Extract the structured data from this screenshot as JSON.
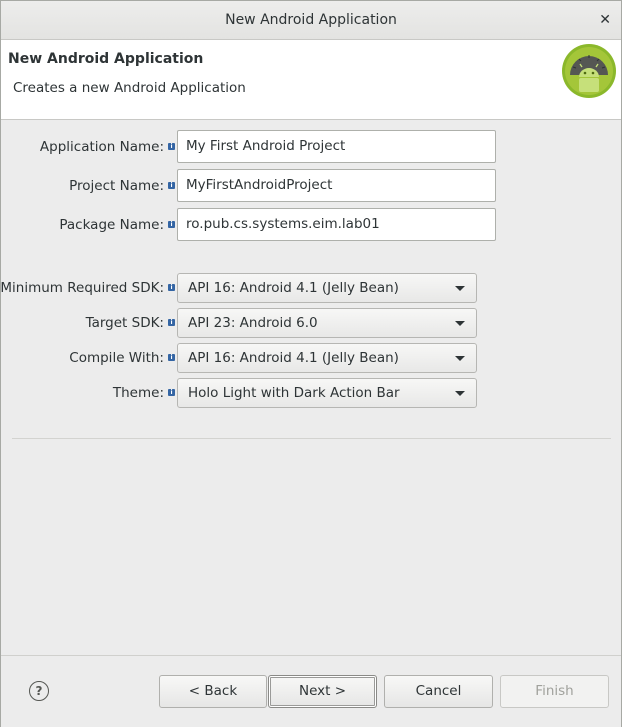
{
  "window": {
    "title": "New Android Application",
    "close_label": "✕"
  },
  "banner": {
    "title": "New Android Application",
    "description": "Creates a new Android Application",
    "logo_icon": "android-logo-icon"
  },
  "fields": {
    "application_name": {
      "label": "Application Name:",
      "value": "My First Android Project"
    },
    "project_name": {
      "label": "Project Name:",
      "value": "MyFirstAndroidProject"
    },
    "package_name": {
      "label": "Package Name:",
      "value": "ro.pub.cs.systems.eim.lab01"
    }
  },
  "selects": {
    "min_sdk": {
      "label": "Minimum Required SDK:",
      "value": "API 16: Android 4.1 (Jelly Bean)"
    },
    "target_sdk": {
      "label": "Target SDK:",
      "value": "API 23: Android 6.0"
    },
    "compile_with": {
      "label": "Compile With:",
      "value": "API 16: Android 4.1 (Jelly Bean)"
    },
    "theme": {
      "label": "Theme:",
      "value": "Holo Light with Dark Action Bar"
    }
  },
  "info_glyph": "i",
  "footer": {
    "help_label": "?",
    "back_label": "< Back",
    "next_label": "Next >",
    "cancel_label": "Cancel",
    "finish_label": "Finish"
  },
  "colors": {
    "info_icon": "#3465a4",
    "android_green": "#a4c639"
  }
}
